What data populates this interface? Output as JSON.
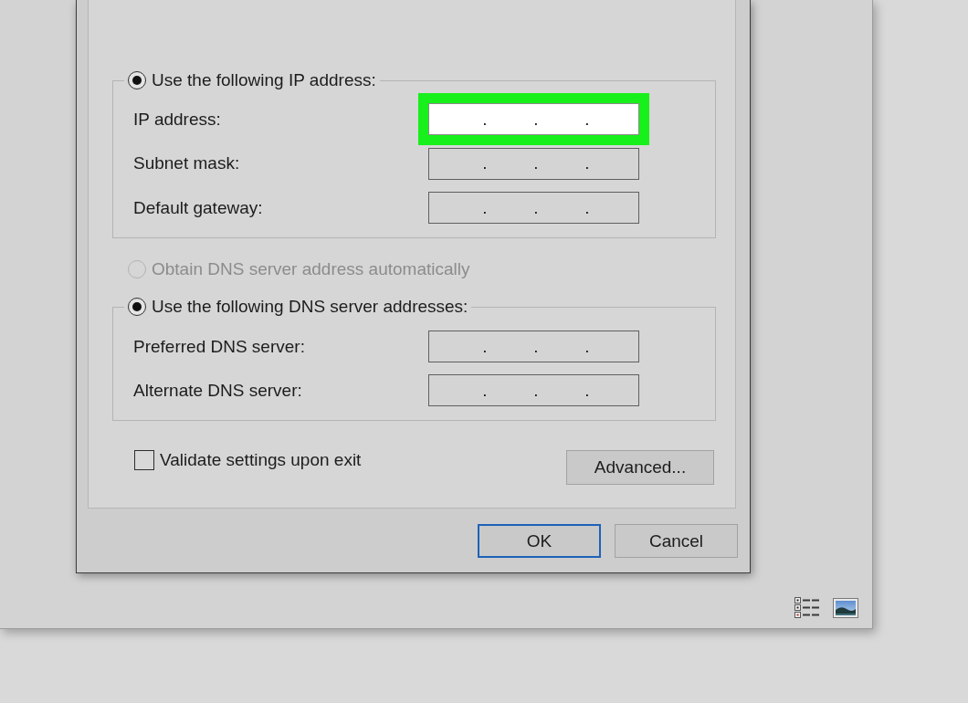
{
  "dialog": {
    "options": [
      {
        "kind": "group",
        "label": "Use the following IP address:",
        "selected": true,
        "disabled": false,
        "fields": [
          {
            "label": "IP address:",
            "separators": [
              ".",
              ".",
              "."
            ],
            "highlighted": true
          },
          {
            "label": "Subnet mask:",
            "separators": [
              ".",
              ".",
              "."
            ],
            "highlighted": false
          },
          {
            "label": "Default gateway:",
            "separators": [
              ".",
              ".",
              "."
            ],
            "highlighted": false
          }
        ]
      },
      {
        "kind": "radio",
        "label": "Obtain DNS server address automatically",
        "selected": false,
        "disabled": true
      },
      {
        "kind": "group",
        "label": "Use the following DNS server addresses:",
        "selected": true,
        "disabled": false,
        "fields": [
          {
            "label": "Preferred DNS server:",
            "separators": [
              ".",
              ".",
              "."
            ],
            "highlighted": false
          },
          {
            "label": "Alternate DNS server:",
            "separators": [
              ".",
              ".",
              "."
            ],
            "highlighted": false
          }
        ]
      }
    ],
    "validate_checkbox": {
      "label": "Validate settings upon exit",
      "checked": false
    },
    "advanced_button": {
      "label": "Advanced..."
    },
    "buttons": [
      {
        "label": "OK",
        "default": true
      },
      {
        "label": "Cancel",
        "default": false
      }
    ]
  }
}
